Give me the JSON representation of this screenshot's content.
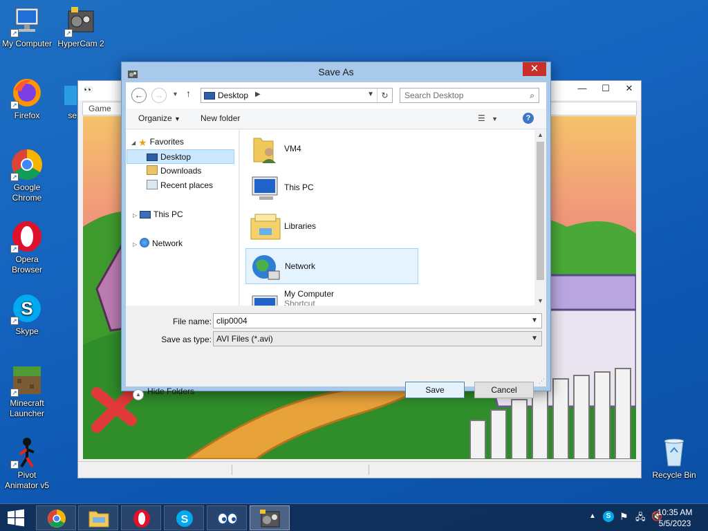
{
  "desktop": {
    "icons": [
      {
        "label": "My Computer",
        "icon": "monitor-icon"
      },
      {
        "label": "HyperCam 2",
        "icon": "camera-icon"
      },
      {
        "label": "Firefox",
        "icon": "firefox-icon"
      },
      {
        "label": "se",
        "icon": "shortcut-icon"
      },
      {
        "label": "Google Chrome",
        "icon": "chrome-icon"
      },
      {
        "label": "Opera Browser",
        "icon": "opera-icon"
      },
      {
        "label": "Skype",
        "icon": "skype-icon"
      },
      {
        "label": "Minecraft Launcher",
        "icon": "minecraft-icon"
      },
      {
        "label": "Pivot Animator v5",
        "icon": "stickman-icon"
      },
      {
        "label": "Recycle Bin",
        "icon": "recycle-bin-icon"
      }
    ]
  },
  "game_window": {
    "menu": [
      "Game"
    ]
  },
  "dialog": {
    "title": "Save As",
    "address": {
      "location": "Desktop"
    },
    "search": {
      "placeholder": "Search Desktop"
    },
    "toolbar": {
      "organize": "Organize",
      "new_folder": "New folder"
    },
    "nav": {
      "favorites": "Favorites",
      "desktop": "Desktop",
      "downloads": "Downloads",
      "recent": "Recent places",
      "this_pc": "This PC",
      "network": "Network"
    },
    "files": [
      {
        "name": "VM4",
        "sub": "",
        "icon": "user-folder-icon"
      },
      {
        "name": "This PC",
        "sub": "",
        "icon": "computer-icon"
      },
      {
        "name": "Libraries",
        "sub": "",
        "icon": "libraries-icon"
      },
      {
        "name": "Network",
        "sub": "",
        "icon": "network-icon",
        "selected": true
      },
      {
        "name": "My Computer",
        "sub": "Shortcut",
        "icon": "computer-icon"
      }
    ],
    "file_name_label": "File name:",
    "file_name_value": "clip0004",
    "save_type_label": "Save as type:",
    "save_type_value": "AVI Files (*.avi)",
    "hide_folders": "Hide Folders",
    "save_button": "Save",
    "cancel_button": "Cancel"
  },
  "taskbar": {
    "apps": [
      "chrome-icon",
      "file-explorer-icon",
      "opera-icon",
      "skype-icon",
      "eyes-app-icon",
      "hypercam-icon"
    ],
    "time": "10:35 AM",
    "date": "5/5/2023"
  }
}
